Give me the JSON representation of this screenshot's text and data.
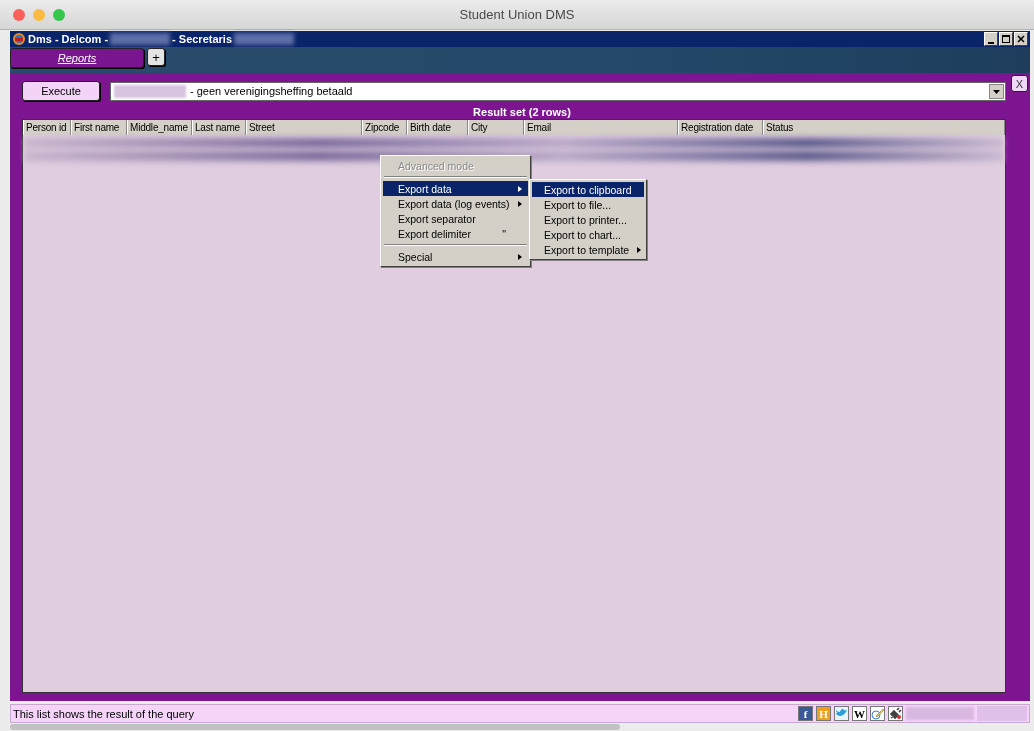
{
  "window": {
    "title": "Student Union DMS"
  },
  "app_titlebar": {
    "parts": [
      {
        "kind": "text",
        "text": "Dms - Delcom -"
      },
      {
        "kind": "blur"
      },
      {
        "kind": "text",
        "text": "- Secretaris"
      },
      {
        "kind": "blur"
      }
    ]
  },
  "tabs": [
    {
      "label": "Reports",
      "selected": true
    }
  ],
  "add_tab": "+",
  "close_panel": "X",
  "execute_button": "Execute",
  "query_select": {
    "value": "- geen verenigingsheffing betaald"
  },
  "result_title": "Result set (2 rows)",
  "table": {
    "columns": [
      "Person id",
      "First name",
      "Middle_name",
      "Last name",
      "Street",
      "Zipcode",
      "Birth date",
      "City",
      "Email",
      "Registration date",
      "Status"
    ]
  },
  "context_menu": {
    "items": [
      {
        "kind": "item",
        "label": "Advanced mode",
        "disabled": true,
        "selected": false,
        "submenu": false
      },
      {
        "kind": "separator"
      },
      {
        "kind": "item",
        "label": "Export data",
        "disabled": false,
        "selected": true,
        "submenu": true
      },
      {
        "kind": "item",
        "label": "Export data (log events)",
        "disabled": false,
        "selected": false,
        "submenu": true
      },
      {
        "kind": "item",
        "label": "Export separator",
        "disabled": false,
        "selected": false,
        "submenu": false
      },
      {
        "kind": "item",
        "label": "Export delimiter",
        "disabled": false,
        "selected": false,
        "submenu": false,
        "hint": "\""
      },
      {
        "kind": "separator"
      },
      {
        "kind": "item",
        "label": "Special",
        "disabled": false,
        "selected": false,
        "submenu": true
      }
    ]
  },
  "submenu": {
    "items": [
      {
        "label": "Export to clipboard",
        "selected": true,
        "submenu": false
      },
      {
        "label": "Export to file...",
        "selected": false,
        "submenu": false
      },
      {
        "label": "Export to printer...",
        "selected": false,
        "submenu": false
      },
      {
        "label": "Export to chart...",
        "selected": false,
        "submenu": false
      },
      {
        "label": "Export to template",
        "selected": false,
        "submenu": true
      }
    ]
  },
  "status_bar": {
    "text": "This list shows the result of the query",
    "icons": [
      {
        "kind": "letter",
        "glyph": "f",
        "color": "#3b5998"
      },
      {
        "kind": "letter",
        "glyph": "H",
        "color": "#f0a020"
      },
      {
        "kind": "bird"
      },
      {
        "kind": "letter",
        "glyph": "W",
        "color": "#ffffff"
      },
      {
        "kind": "pencil"
      },
      {
        "kind": "plug"
      }
    ]
  }
}
